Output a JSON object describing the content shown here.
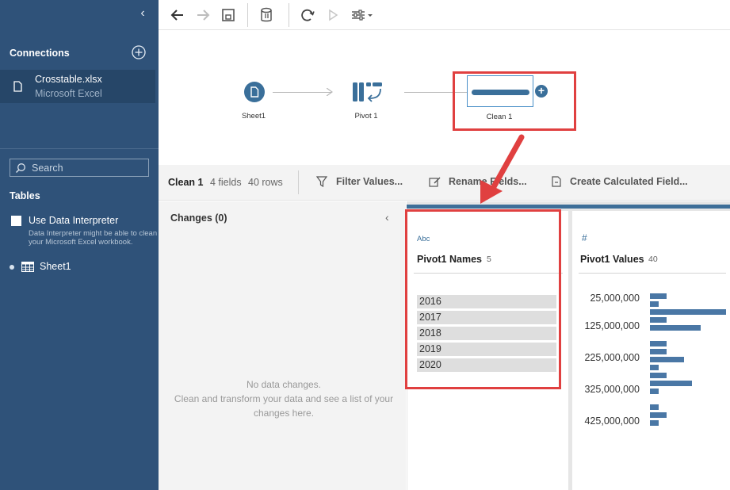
{
  "sidebar": {
    "collapse_icon": "chevron-left-icon",
    "connections_heading": "Connections",
    "connection": {
      "name": "Crosstable.xlsx",
      "type": "Microsoft Excel"
    },
    "search_placeholder": "Search",
    "tables_heading": "Tables",
    "data_interpreter": {
      "label": "Use Data Interpreter",
      "description": "Data Interpreter might be able to clean your Microsoft Excel workbook."
    },
    "tables": [
      {
        "label": "Sheet1"
      }
    ]
  },
  "toolbar": {
    "icons": [
      "back-icon",
      "forward-icon",
      "save-icon",
      "data-icon",
      "refresh-icon",
      "run-icon",
      "settings-icon"
    ]
  },
  "flow": {
    "nodes": [
      {
        "label": "Sheet1",
        "icon": "file-icon"
      },
      {
        "label": "Pivot 1",
        "icon": "pivot-icon"
      },
      {
        "label": "Clean 1",
        "icon": "clean-icon"
      }
    ]
  },
  "step": {
    "name": "Clean 1",
    "fields": "4 fields",
    "rows": "40 rows",
    "actions": {
      "filter": "Filter Values...",
      "rename": "Rename Fields...",
      "calculated": "Create Calculated Field..."
    }
  },
  "changes": {
    "title": "Changes (0)",
    "empty_title": "No data changes.",
    "empty_body": "Clean and transform your data and see a list of your changes here."
  },
  "profile": {
    "accent_color": "#3d6e98",
    "cards": [
      {
        "type_label": "Abc",
        "title": "Pivot1 Names",
        "count": "5",
        "values": [
          "2016",
          "2017",
          "2018",
          "2019",
          "2020"
        ]
      },
      {
        "type_label": "#",
        "title": "Pivot1 Values",
        "count": "40",
        "axis_labels": [
          "25,000,000",
          "125,000,000",
          "225,000,000",
          "325,000,000",
          "425,000,000"
        ],
        "bin_counts": [
          2,
          1,
          9,
          2,
          6,
          0,
          2,
          2,
          4,
          1,
          2,
          5,
          1,
          0,
          1,
          2,
          1
        ]
      }
    ]
  },
  "annotation": {
    "color": "#e04040"
  }
}
